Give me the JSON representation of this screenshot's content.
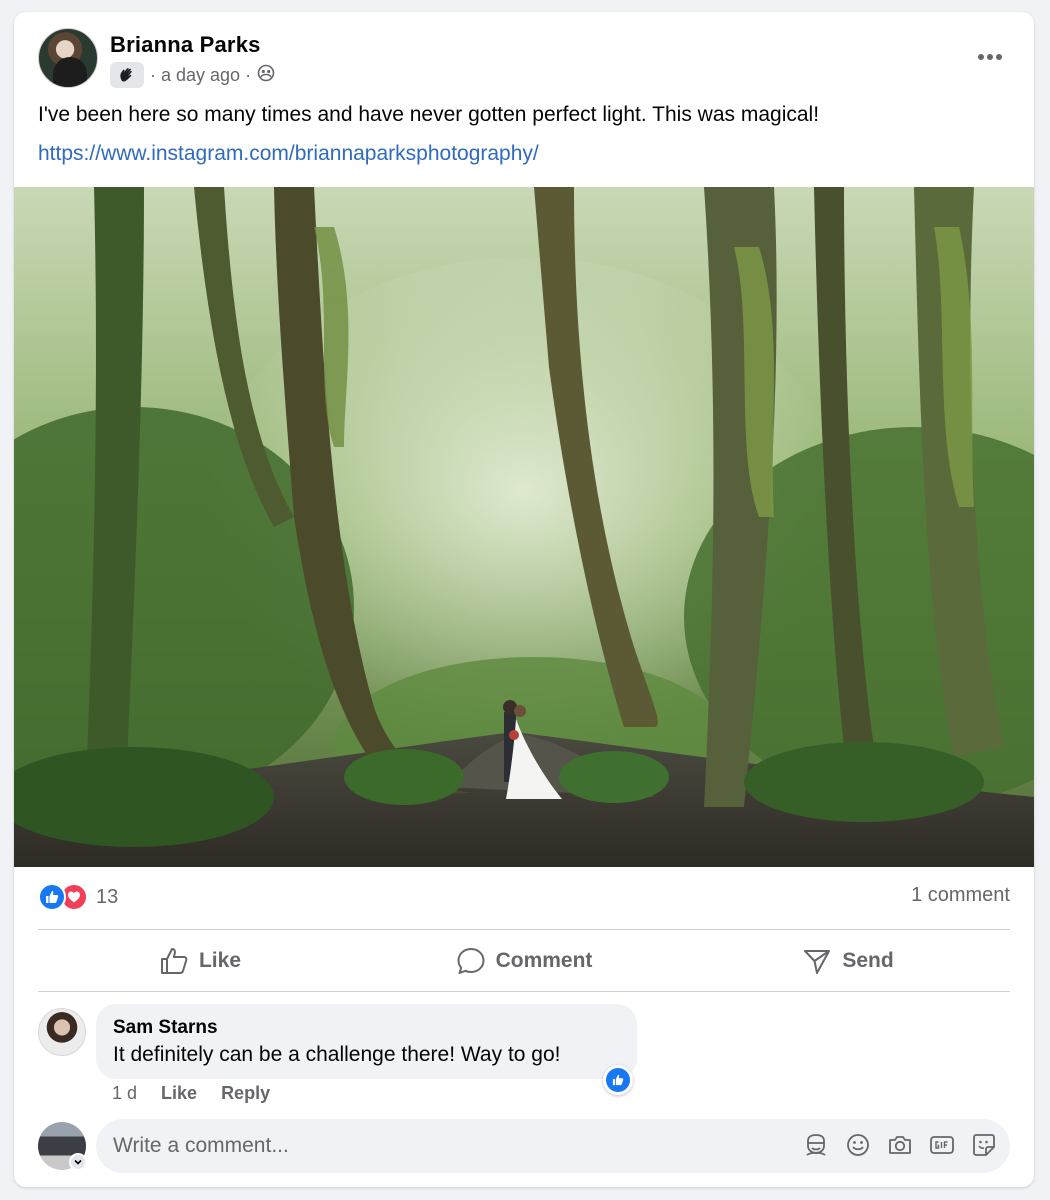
{
  "post": {
    "author": "Brianna Parks",
    "time": "· a day ago ·",
    "text": "I've been here so many times and have never gotten perfect light. This was magical!",
    "link": "https://www.instagram.com/briannaparksphotography/",
    "group_badge_icon": "waving-hand-icon",
    "audience_icon": "group-icon",
    "more_icon": "more-horizontal-icon"
  },
  "stats": {
    "reactions_count": "13",
    "reaction_types": [
      "like",
      "love"
    ],
    "comments_count": "1 comment"
  },
  "actions": {
    "like": "Like",
    "comment": "Comment",
    "send": "Send"
  },
  "comment": {
    "author": "Sam Starns",
    "text": "It definitely can be a challenge there! Way to go!",
    "time": "1 d",
    "like": "Like",
    "reply": "Reply",
    "reaction": "like"
  },
  "composer": {
    "placeholder": "Write a comment...",
    "icons": [
      "avatar-sticker-icon",
      "emoji-icon",
      "camera-icon",
      "gif-icon",
      "sticker-icon"
    ]
  },
  "colors": {
    "link": "#2f6ac0",
    "like_blue": "#1877f2",
    "love_red": "#f33e58",
    "secondary_text": "#65676b"
  }
}
